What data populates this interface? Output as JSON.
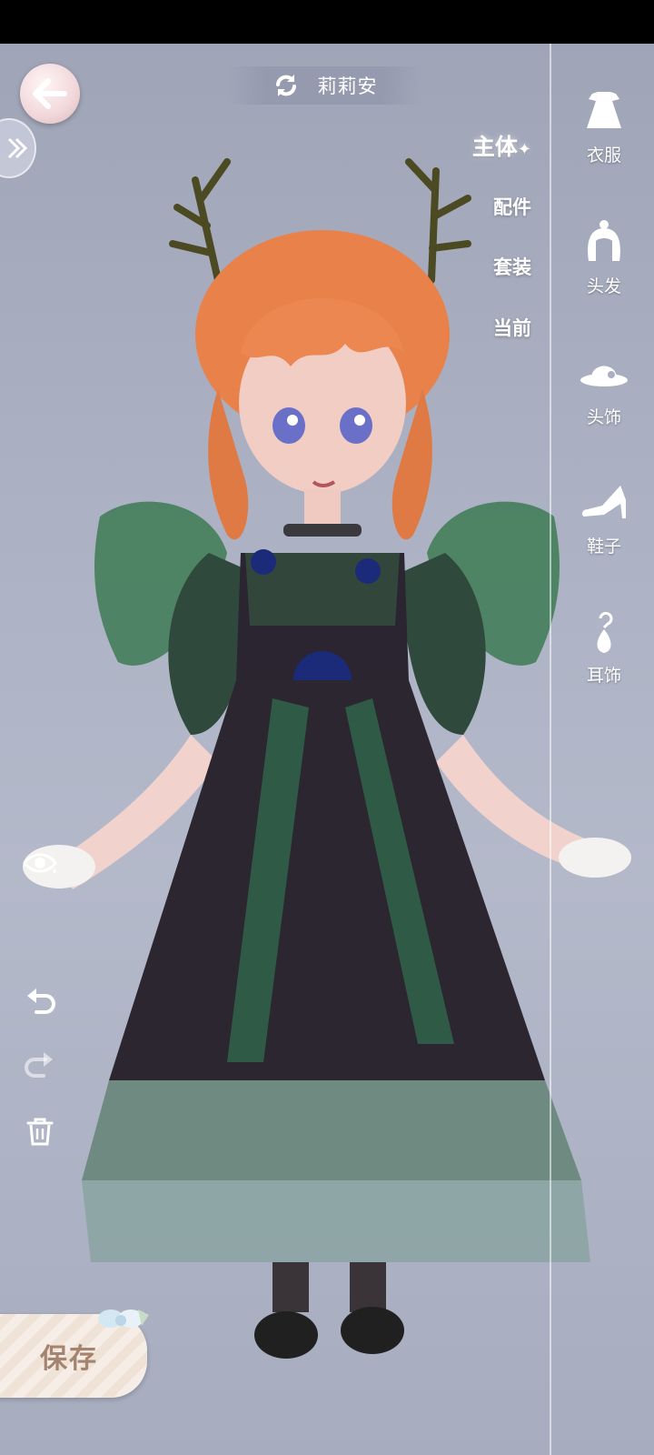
{
  "header": {
    "character_name": "莉莉安"
  },
  "subtabs": [
    {
      "label": "主体",
      "active": true
    },
    {
      "label": "配件",
      "active": false
    },
    {
      "label": "套装",
      "active": false
    },
    {
      "label": "当前",
      "active": false
    }
  ],
  "categories": [
    {
      "label": "衣服",
      "icon": "dress-icon"
    },
    {
      "label": "头发",
      "icon": "hair-icon"
    },
    {
      "label": "头饰",
      "icon": "hat-icon"
    },
    {
      "label": "鞋子",
      "icon": "shoe-icon"
    },
    {
      "label": "耳饰",
      "icon": "earring-icon"
    }
  ],
  "actions": {
    "save_label": "保存"
  },
  "colors": {
    "accent": "#a4846f",
    "dress": "#2e2a33",
    "hair": "#e9814a",
    "leaf": "#2f6b4b"
  }
}
